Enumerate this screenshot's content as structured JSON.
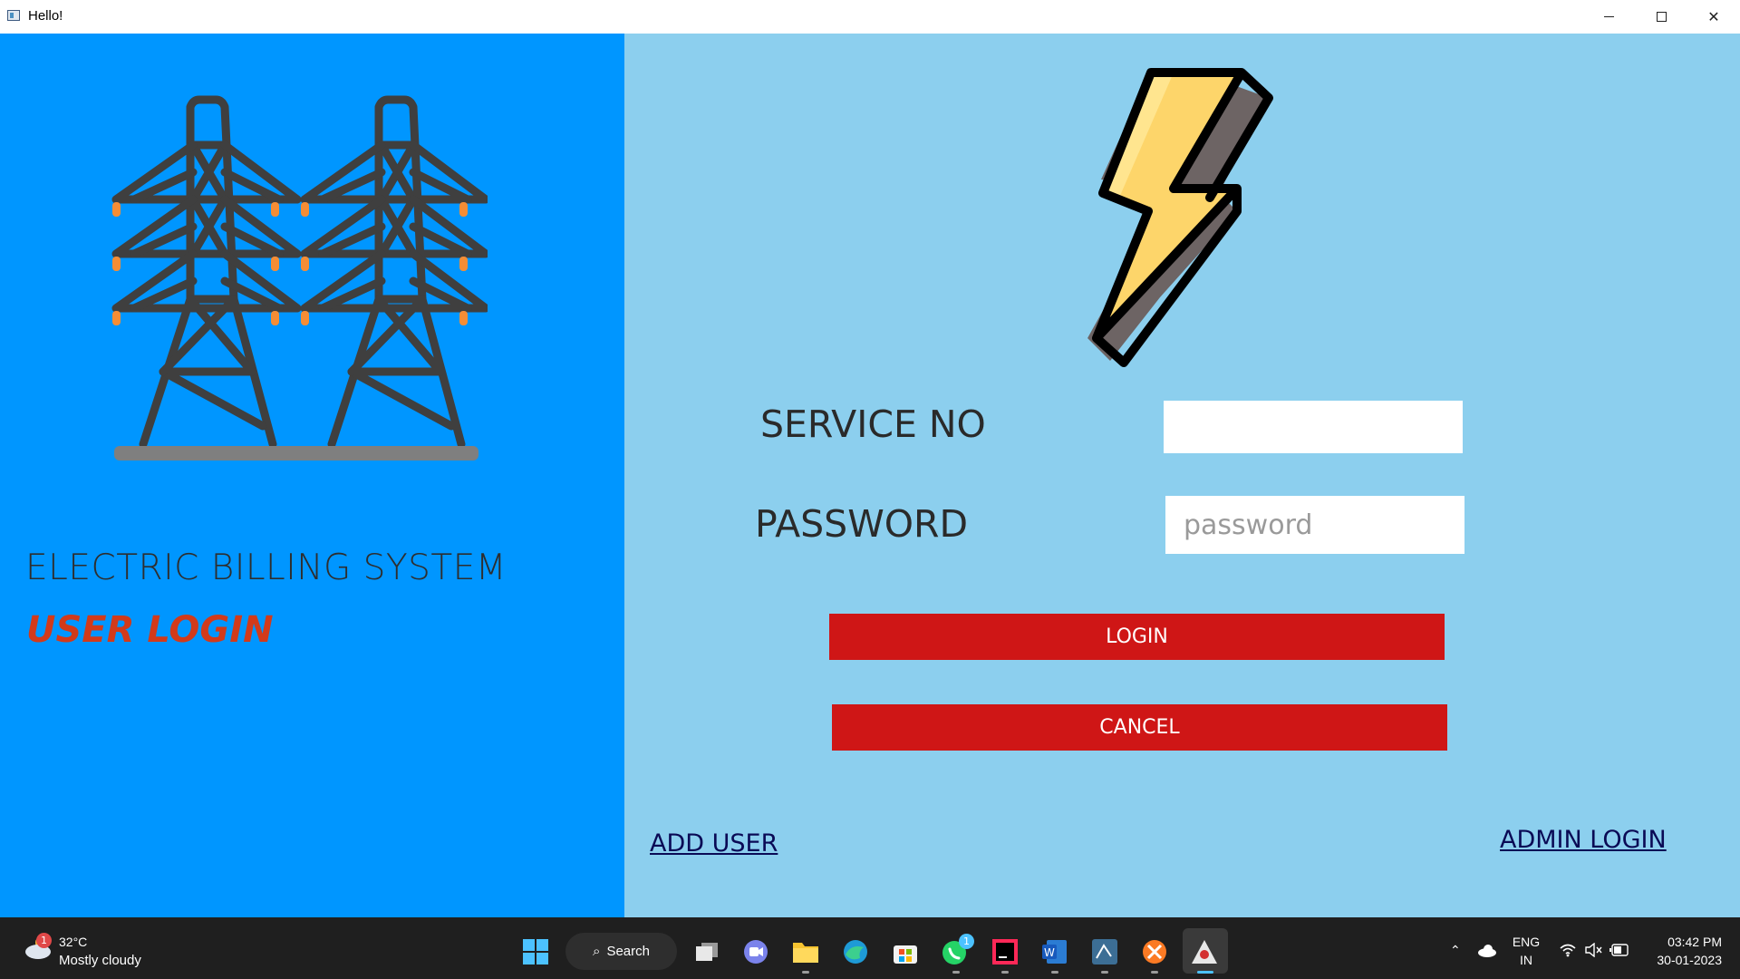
{
  "window": {
    "title": "Hello!"
  },
  "left": {
    "system_title": "ELECTRIC BILLING SYSTEM",
    "subtitle": "USER LOGIN"
  },
  "form": {
    "service_label": "SERVICE NO",
    "service_value": "",
    "password_label": "PASSWORD",
    "password_placeholder": "password",
    "login_label": "LOGIN",
    "cancel_label": "CANCEL",
    "add_user_link": "ADD USER",
    "admin_login_link": "ADMIN LOGIN"
  },
  "colors": {
    "left_panel": "#0096ff",
    "right_panel": "#8ccfee",
    "button": "#cf1616",
    "subtitle": "#d23a1a"
  },
  "taskbar": {
    "weather_temp": "32°C",
    "weather_desc": "Mostly cloudy",
    "weather_badge": "1",
    "search_label": "Search",
    "whatsapp_badge": "1",
    "lang_top": "ENG",
    "lang_bottom": "IN",
    "time": "03:42 PM",
    "date": "30-01-2023",
    "icons": [
      "start-icon",
      "search-icon",
      "task-view-icon",
      "teams-chat-icon",
      "file-explorer-icon",
      "edge-icon",
      "store-icon",
      "whatsapp-icon",
      "intellij-icon",
      "word-icon",
      "mysql-workbench-icon",
      "xampp-icon",
      "java-app-icon"
    ]
  }
}
